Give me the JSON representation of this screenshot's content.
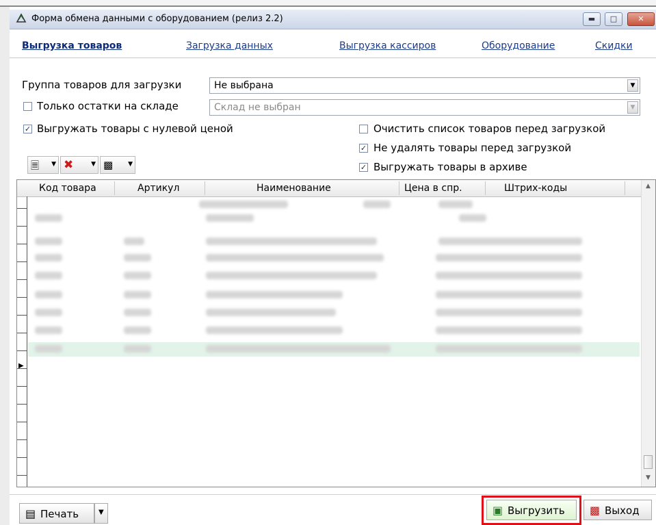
{
  "window": {
    "title": "Форма обмена данными с оборудованием (релиз 2.2)",
    "icons": {
      "app": "recycle-app-icon",
      "minimize": "minimize-icon",
      "maximize": "maximize-icon",
      "close": "close-icon"
    }
  },
  "tabs": [
    {
      "label": "Выгрузка товаров",
      "active": true
    },
    {
      "label": "Загрузка данных",
      "active": false
    },
    {
      "label": "Выгрузка кассиров",
      "active": false
    },
    {
      "label": "Оборудование",
      "active": false
    },
    {
      "label": "Скидки",
      "active": false
    }
  ],
  "filters": {
    "group_label": "Группа товаров для загрузки",
    "group_value": "Не выбрана",
    "stock_only_label": "Только остатки на складе",
    "stock_only_checked": false,
    "warehouse_value": "Склад не выбран"
  },
  "options": {
    "zero_price": {
      "label": "Выгружать товары с нулевой ценой",
      "checked": true
    },
    "clear_list": {
      "label": "Очистить список товаров перед загрузкой",
      "checked": false
    },
    "no_delete": {
      "label": "Не удалять товары перед загрузкой",
      "checked": true
    },
    "archive": {
      "label": "Выгружать товары в архиве",
      "checked": true
    }
  },
  "toolbar": {
    "icons": [
      "add-item-icon",
      "delete-icon",
      "select-icon"
    ]
  },
  "grid": {
    "columns": [
      "Код товара",
      "Артикул",
      "Наименование",
      "Цена в спр.",
      "Штрих-коды"
    ],
    "selected_row": 10
  },
  "footer": {
    "print_label": "Печать",
    "export_label": "Выгрузить",
    "exit_label": "Выход",
    "accent_highlight": "#e0101a"
  }
}
